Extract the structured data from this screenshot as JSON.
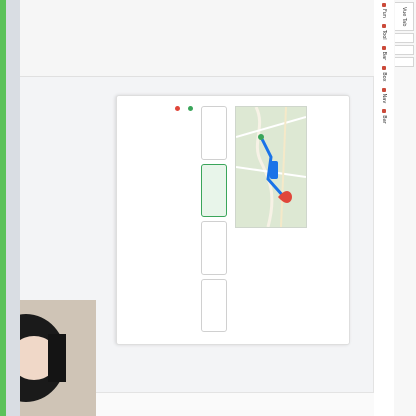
{
  "browser": {
    "tabs": [
      "Vue Tab",
      "",
      "",
      "",
      "",
      "",
      ""
    ]
  },
  "bookmarks": [
    {
      "label": "Fun"
    },
    {
      "label": "Tool"
    },
    {
      "label": "Bar"
    },
    {
      "label": "Box"
    },
    {
      "label": "Nav"
    },
    {
      "label": "Bar"
    }
  ],
  "left_panel": {
    "lines": [
      "",
      "",
      "",
      "",
      ""
    ]
  },
  "card": {
    "title": "",
    "subtitle": "",
    "header": "",
    "route": {
      "duration": "",
      "distance": "",
      "detail": ""
    },
    "modes": [
      "",
      "",
      "",
      ""
    ],
    "from": "",
    "to": ""
  },
  "overlay": {
    "chat_lines": [
      {
        "text": "",
        "color": "#ffb800"
      },
      {
        "text": "",
        "color": "#5fd35a"
      },
      {
        "text": "",
        "color": "#ffffff"
      }
    ]
  },
  "colors": {
    "accent": "#1a73e8",
    "green": "#5cc25a",
    "origin": "#3aa55a",
    "destination": "#e0463a"
  }
}
